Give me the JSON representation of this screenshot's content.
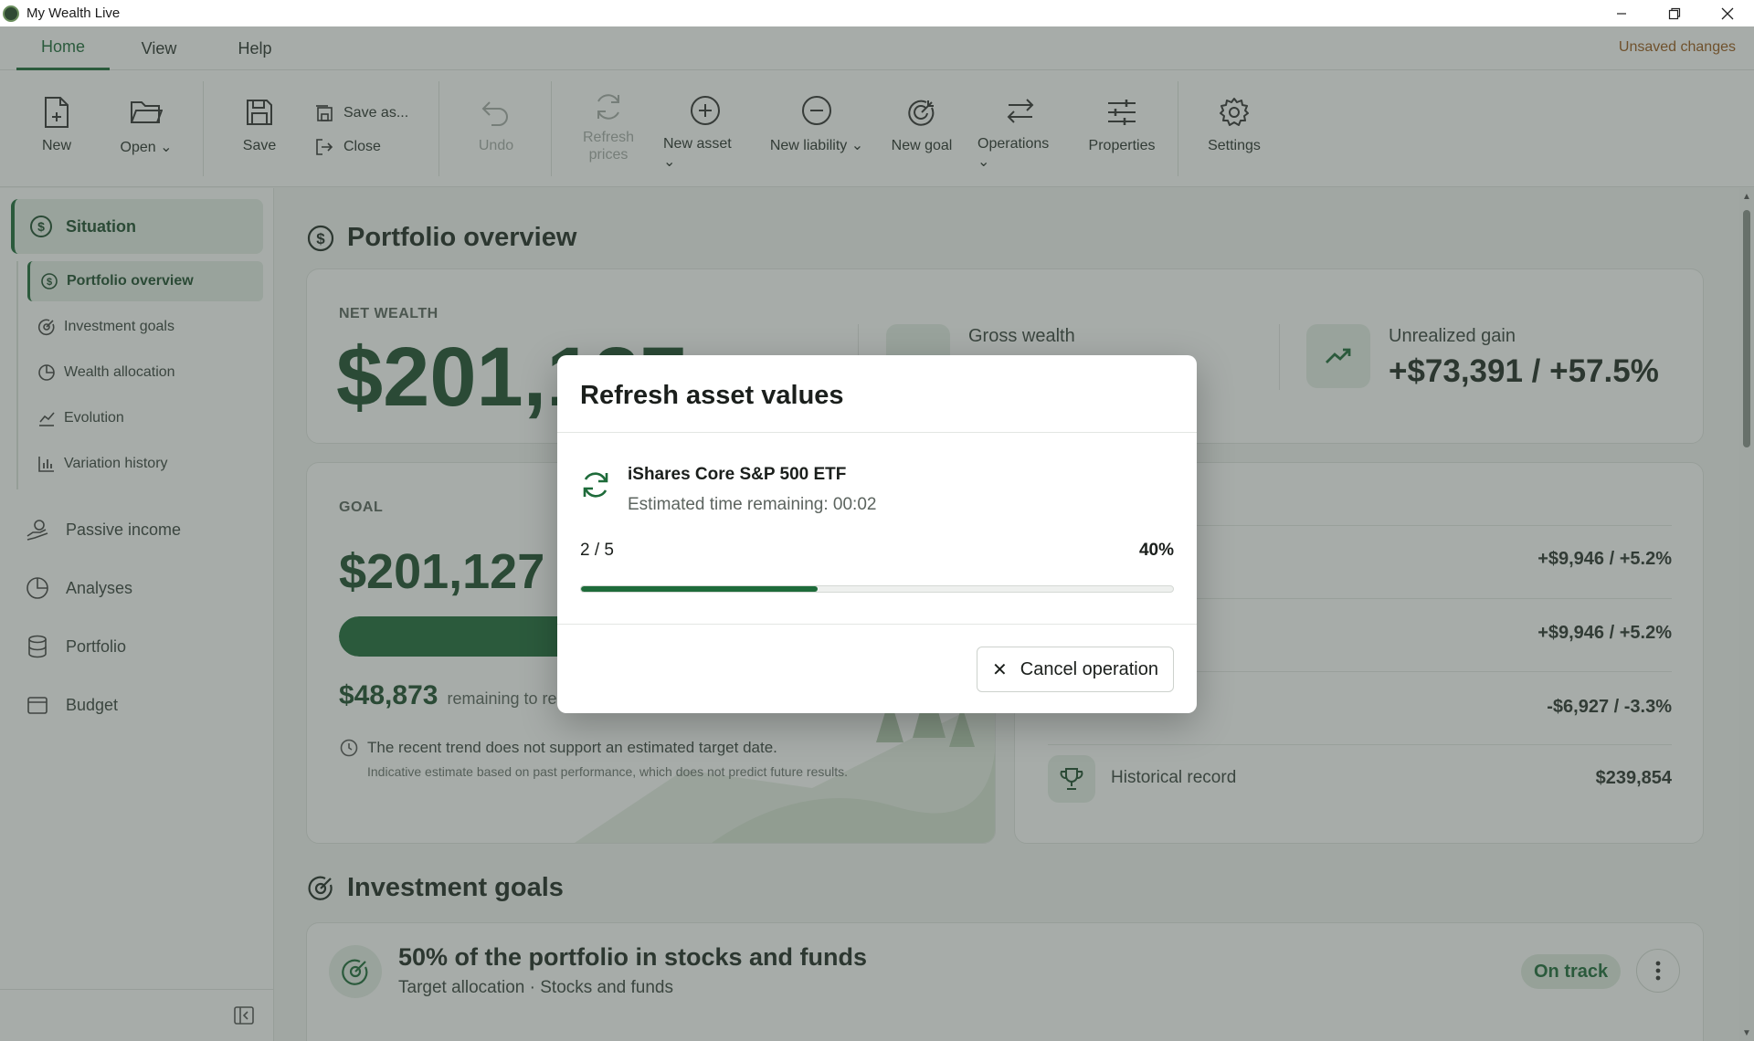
{
  "window": {
    "title": "My Wealth Live"
  },
  "menu": {
    "tabs": [
      "Home",
      "View",
      "Help"
    ],
    "status": "Unsaved changes"
  },
  "toolbar": {
    "new": "New",
    "open": "Open",
    "save": "Save",
    "save_as": "Save as...",
    "close": "Close",
    "undo": "Undo",
    "refresh_line1": "Refresh",
    "refresh_line2": "prices",
    "new_asset": "New asset",
    "new_liability": "New liability",
    "new_goal": "New goal",
    "operations": "Operations",
    "properties": "Properties",
    "settings": "Settings"
  },
  "sidebar": {
    "section": "Situation",
    "sub_items": [
      "Portfolio overview",
      "Investment goals",
      "Wealth allocation",
      "Evolution",
      "Variation history"
    ],
    "main_items": [
      "Passive income",
      "Analyses",
      "Portfolio",
      "Budget"
    ]
  },
  "main": {
    "overview_title": "Portfolio overview",
    "net_wealth_label": "NET WEALTH",
    "net_wealth_value": "$201,127",
    "gross_wealth_label": "Gross wealth",
    "unrealized_label": "Unrealized gain",
    "unrealized_value": "+$73,391 / +57.5%",
    "goal_label": "GOAL",
    "goal_value": "$201,127",
    "goal_slash": "/",
    "remaining_value": "$48,873",
    "remaining_text": "remaining to rea",
    "trend_note": "The recent trend does not support an estimated target date.",
    "trend_disclaimer": "Indicative estimate based on past performance, which does not predict future results.",
    "variations": [
      "+$9,946 / +5.2%",
      "+$9,946 / +5.2%",
      "-$6,927 / -3.3%"
    ],
    "record_label": "Historical record",
    "record_value": "$239,854",
    "goals_title": "Investment goals",
    "goal_item_title": "50% of the portfolio in stocks and funds",
    "goal_item_sub": "Target allocation · Stocks and funds",
    "goal_item_status": "On track"
  },
  "dialog": {
    "title": "Refresh asset values",
    "asset": "iShares Core S&P 500 ETF",
    "eta": "Estimated time remaining: 00:02",
    "count": "2 / 5",
    "percent": "40%",
    "progress": 0.4,
    "cancel": "Cancel operation"
  },
  "colors": {
    "accent": "#1e6b3a",
    "status_warn": "#9a5a1c"
  }
}
